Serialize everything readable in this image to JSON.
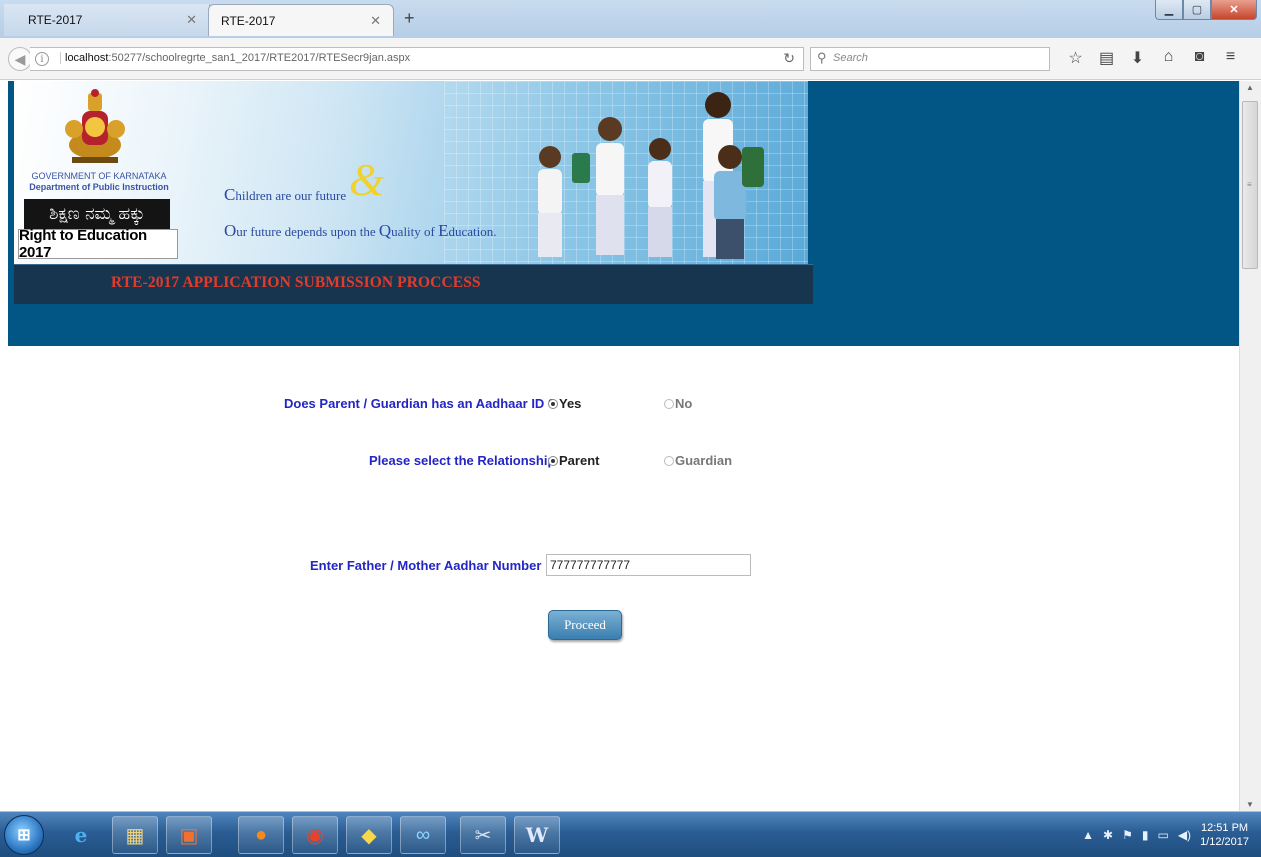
{
  "browser": {
    "tabs": [
      {
        "title": "RTE-2017",
        "active": false
      },
      {
        "title": "RTE-2017",
        "active": true
      }
    ],
    "new_tab_symbol": "+",
    "url_host": "localhost",
    "url_rest": ":50277/schoolregrte_san1_2017/RTE2017/RTESecr9jan.aspx",
    "search_placeholder": "Search",
    "icons": [
      "star-icon",
      "reading-list-icon",
      "download-icon",
      "home-icon",
      "pocket-icon",
      "menu-icon"
    ]
  },
  "banner": {
    "gov_line1": "GOVERNMENT OF KARNATAKA",
    "gov_line2": "Department of Public Instruction",
    "kannada_text": "ಶಿಕ್ಷಣ ನಮ್ಮ ಹಕ್ಕು",
    "rte_text": "Right to Education 2017",
    "tagline1_cap": "C",
    "tagline1_rest": "hildren are our future",
    "tagline2_c1": "O",
    "tagline2_r1": "ur future depends upon the ",
    "tagline2_c2": "Q",
    "tagline2_r2": "uality of ",
    "tagline2_c3": "E",
    "tagline2_r3": "ducation.",
    "ampersand": "&",
    "title": "RTE-2017 APPLICATION SUBMISSION PROCCESS"
  },
  "form": {
    "aadhaar_question": "Does Parent / Guardian has an Aadhaar ID ?",
    "aadhaar_yes": "Yes",
    "aadhaar_no": "No",
    "relationship_question": "Please select the Relationship",
    "relationship_parent": "Parent",
    "relationship_guardian": "Guardian",
    "aadhar_label": "Enter Father / Mother Aadhar Number",
    "aadhar_value": "777777777777",
    "proceed_label": "Proceed"
  },
  "taskbar": {
    "time": "12:51 PM",
    "date": "1/12/2017"
  },
  "colors": {
    "header_band": "#015686",
    "title_bar": "#18354f",
    "title_text": "#e33b2a",
    "form_label": "#2325c4"
  }
}
